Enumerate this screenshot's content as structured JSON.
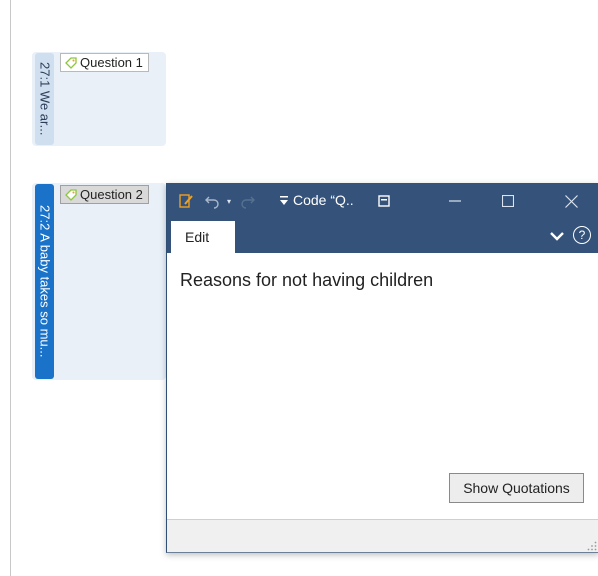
{
  "quotations": [
    {
      "label": "27:1 We ar...",
      "code": "Question 1"
    },
    {
      "label": "27:2 A baby takes so mu...",
      "code": "Question 2"
    }
  ],
  "editor": {
    "title": "Code “Q..",
    "tab": "Edit",
    "content": "Reasons for not having children",
    "show_quotations_button": "Show Quotations",
    "help": "?"
  },
  "colors": {
    "titlebar": "#35537a",
    "selected_bar": "#1a73c9",
    "quote_bg": "#e9f0f8",
    "code_icon_green": "#8dc63f"
  },
  "icons": {
    "title_buttons": [
      "edit-icon",
      "undo-icon",
      "undo-dropdown-icon",
      "redo-icon",
      "customize-quick-access-icon",
      "window-mode-icon",
      "minimize-icon",
      "maximize-icon",
      "close-icon"
    ],
    "ribbon": [
      "collapse-ribbon-chevron-icon",
      "help-icon"
    ]
  }
}
